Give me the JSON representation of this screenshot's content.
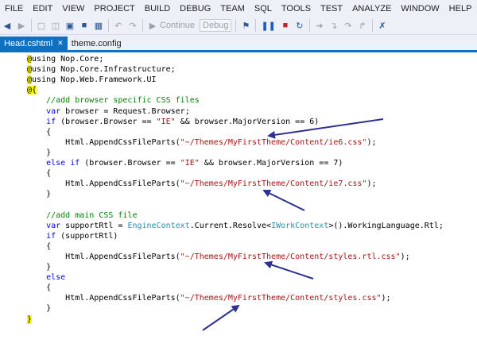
{
  "menu": [
    "FILE",
    "EDIT",
    "VIEW",
    "PROJECT",
    "BUILD",
    "DEBUG",
    "TEAM",
    "SQL",
    "TOOLS",
    "TEST",
    "ANALYZE",
    "WINDOW",
    "HELP"
  ],
  "toolbar": {
    "continue_label": "Continue",
    "config_value": "Debug"
  },
  "tabs": [
    {
      "label": "Head.cshtml",
      "close": "✕"
    },
    {
      "label": "theme.config"
    }
  ],
  "code": [
    [
      {
        "t": "@",
        "c": "hl"
      },
      {
        "t": "using Nop.Core;",
        "c": ""
      }
    ],
    [
      {
        "t": "@",
        "c": "hl"
      },
      {
        "t": "using Nop.Core.Infrastructure;",
        "c": ""
      }
    ],
    [
      {
        "t": "@",
        "c": "hl"
      },
      {
        "t": "using Nop.Web.Framework.UI",
        "c": ""
      }
    ],
    [
      {
        "t": "@{",
        "c": "hl"
      }
    ],
    [
      {
        "t": "    //add browser specific CSS files",
        "c": "cm"
      }
    ],
    [
      {
        "t": "    ",
        "c": ""
      },
      {
        "t": "var",
        "c": "kw"
      },
      {
        "t": " browser = Request.Browser;",
        "c": ""
      }
    ],
    [
      {
        "t": "    ",
        "c": ""
      },
      {
        "t": "if",
        "c": "kw"
      },
      {
        "t": " (browser.Browser == ",
        "c": ""
      },
      {
        "t": "\"IE\"",
        "c": "str"
      },
      {
        "t": " && browser.MajorVersion == 6)",
        "c": ""
      }
    ],
    [
      {
        "t": "    {",
        "c": ""
      }
    ],
    [
      {
        "t": "        Html.AppendCssFileParts(",
        "c": ""
      },
      {
        "t": "\"~/Themes/MyFirstTheme/Content/ie6.css\"",
        "c": "str"
      },
      {
        "t": ");",
        "c": ""
      }
    ],
    [
      {
        "t": "    }",
        "c": ""
      }
    ],
    [
      {
        "t": "    ",
        "c": ""
      },
      {
        "t": "else if",
        "c": "kw"
      },
      {
        "t": " (browser.Browser == ",
        "c": ""
      },
      {
        "t": "\"IE\"",
        "c": "str"
      },
      {
        "t": " && browser.MajorVersion == 7)",
        "c": ""
      }
    ],
    [
      {
        "t": "    {",
        "c": ""
      }
    ],
    [
      {
        "t": "        Html.AppendCssFileParts(",
        "c": ""
      },
      {
        "t": "\"~/Themes/MyFirstTheme/Content/ie7.css\"",
        "c": "str"
      },
      {
        "t": ");",
        "c": ""
      }
    ],
    [
      {
        "t": "    }",
        "c": ""
      }
    ],
    [
      {
        "t": "",
        "c": ""
      }
    ],
    [
      {
        "t": "    //add main CSS file",
        "c": "cm"
      }
    ],
    [
      {
        "t": "    ",
        "c": ""
      },
      {
        "t": "var",
        "c": "kw"
      },
      {
        "t": " supportRtl = ",
        "c": ""
      },
      {
        "t": "EngineContext",
        "c": "ty"
      },
      {
        "t": ".Current.Resolve<",
        "c": ""
      },
      {
        "t": "IWorkContext",
        "c": "ty"
      },
      {
        "t": ">().WorkingLanguage.Rtl;",
        "c": ""
      }
    ],
    [
      {
        "t": "    ",
        "c": ""
      },
      {
        "t": "if",
        "c": "kw"
      },
      {
        "t": " (supportRtl)",
        "c": ""
      }
    ],
    [
      {
        "t": "    {",
        "c": ""
      }
    ],
    [
      {
        "t": "        Html.AppendCssFileParts(",
        "c": ""
      },
      {
        "t": "\"~/Themes/MyFirstTheme/Content/styles.rtl.css\"",
        "c": "str"
      },
      {
        "t": ");",
        "c": ""
      }
    ],
    [
      {
        "t": "    }",
        "c": ""
      }
    ],
    [
      {
        "t": "    ",
        "c": ""
      },
      {
        "t": "else",
        "c": "kw"
      }
    ],
    [
      {
        "t": "    {",
        "c": ""
      }
    ],
    [
      {
        "t": "        Html.AppendCssFileParts(",
        "c": ""
      },
      {
        "t": "\"~/Themes/MyFirstTheme/Content/styles.css\"",
        "c": "str"
      },
      {
        "t": ");",
        "c": ""
      }
    ],
    [
      {
        "t": "    }",
        "c": ""
      }
    ],
    [
      {
        "t": "}",
        "c": "hl"
      }
    ]
  ],
  "colors": {
    "accent": "#0e70c0",
    "arrow": "#2e3192",
    "highlight": "#ffff00"
  }
}
